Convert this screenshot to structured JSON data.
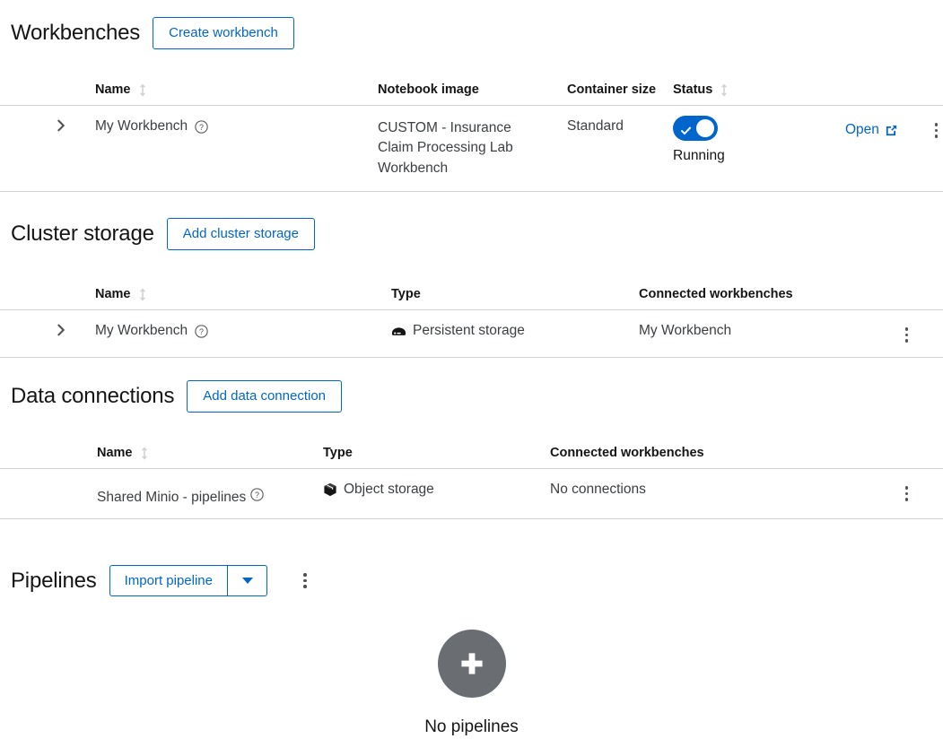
{
  "workbenches": {
    "title": "Workbenches",
    "create_button": "Create workbench",
    "columns": {
      "name": "Name",
      "notebook_image": "Notebook image",
      "container_size": "Container size",
      "status": "Status"
    },
    "rows": [
      {
        "name": "My Workbench",
        "notebook_image": "CUSTOM - Insurance Claim Processing Lab Workbench",
        "container_size": "Standard",
        "status_label": "Running",
        "status_on": true,
        "open_label": "Open"
      }
    ]
  },
  "cluster_storage": {
    "title": "Cluster storage",
    "add_button": "Add cluster storage",
    "columns": {
      "name": "Name",
      "type": "Type",
      "connected": "Connected workbenches"
    },
    "rows": [
      {
        "name": "My Workbench",
        "type": "Persistent storage",
        "type_icon": "persistent-storage-icon",
        "connected": "My Workbench"
      }
    ]
  },
  "data_connections": {
    "title": "Data connections",
    "add_button": "Add data connection",
    "columns": {
      "name": "Name",
      "type": "Type",
      "connected": "Connected workbenches"
    },
    "rows": [
      {
        "name": "Shared Minio - pipelines",
        "type": "Object storage",
        "type_icon": "object-storage-icon",
        "connected": "No connections"
      }
    ]
  },
  "pipelines": {
    "title": "Pipelines",
    "import_button": "Import pipeline",
    "empty_title": "No pipelines"
  },
  "icons": {
    "sort": "sort-icon",
    "help": "help-icon",
    "expand": "chevron-right-icon",
    "kebab": "kebab-menu-icon",
    "external_link": "external-link-icon",
    "plus": "plus-icon"
  },
  "colors": {
    "link": "#0066cc",
    "toggle_on": "#0066cc",
    "border": "#d2d2d2",
    "text": "#151515",
    "muted": "#6a6e73"
  }
}
